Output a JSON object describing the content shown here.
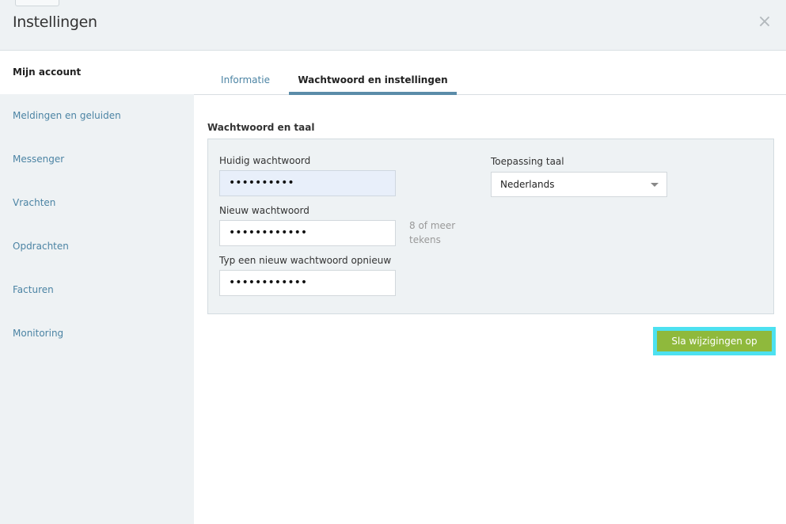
{
  "header": {
    "title": "Instellingen",
    "close_symbol": "×",
    "close_icon": "close-icon"
  },
  "sidebar": {
    "items": [
      {
        "label": "Mijn account",
        "active": true
      },
      {
        "label": "Meldingen en geluiden",
        "active": false
      },
      {
        "label": "Messenger",
        "active": false
      },
      {
        "label": "Vrachten",
        "active": false
      },
      {
        "label": "Opdrachten",
        "active": false
      },
      {
        "label": "Facturen",
        "active": false
      },
      {
        "label": "Monitoring",
        "active": false
      }
    ]
  },
  "tabs": [
    {
      "label": "Informatie",
      "active": false
    },
    {
      "label": "Wachtwoord en instellingen",
      "active": true
    }
  ],
  "section": {
    "title": "Wachtwoord en taal"
  },
  "form": {
    "current_password": {
      "label": "Huidig wachtwoord",
      "value": "••••••••••"
    },
    "new_password": {
      "label": "Nieuw wachtwoord",
      "value": "••••••••••••"
    },
    "repeat_password": {
      "label": "Typ een nieuw wachtwoord opnieuw",
      "value": "••••••••••••"
    },
    "hint": "8 of meer tekens",
    "language": {
      "label": "Toepassing taal",
      "value": "Nederlands"
    }
  },
  "actions": {
    "save_label": "Sla wijzigingen op"
  },
  "colors": {
    "accent_blue": "#4c84a4",
    "save_green": "#8fb93c",
    "focus_outline": "#4de1f0"
  }
}
